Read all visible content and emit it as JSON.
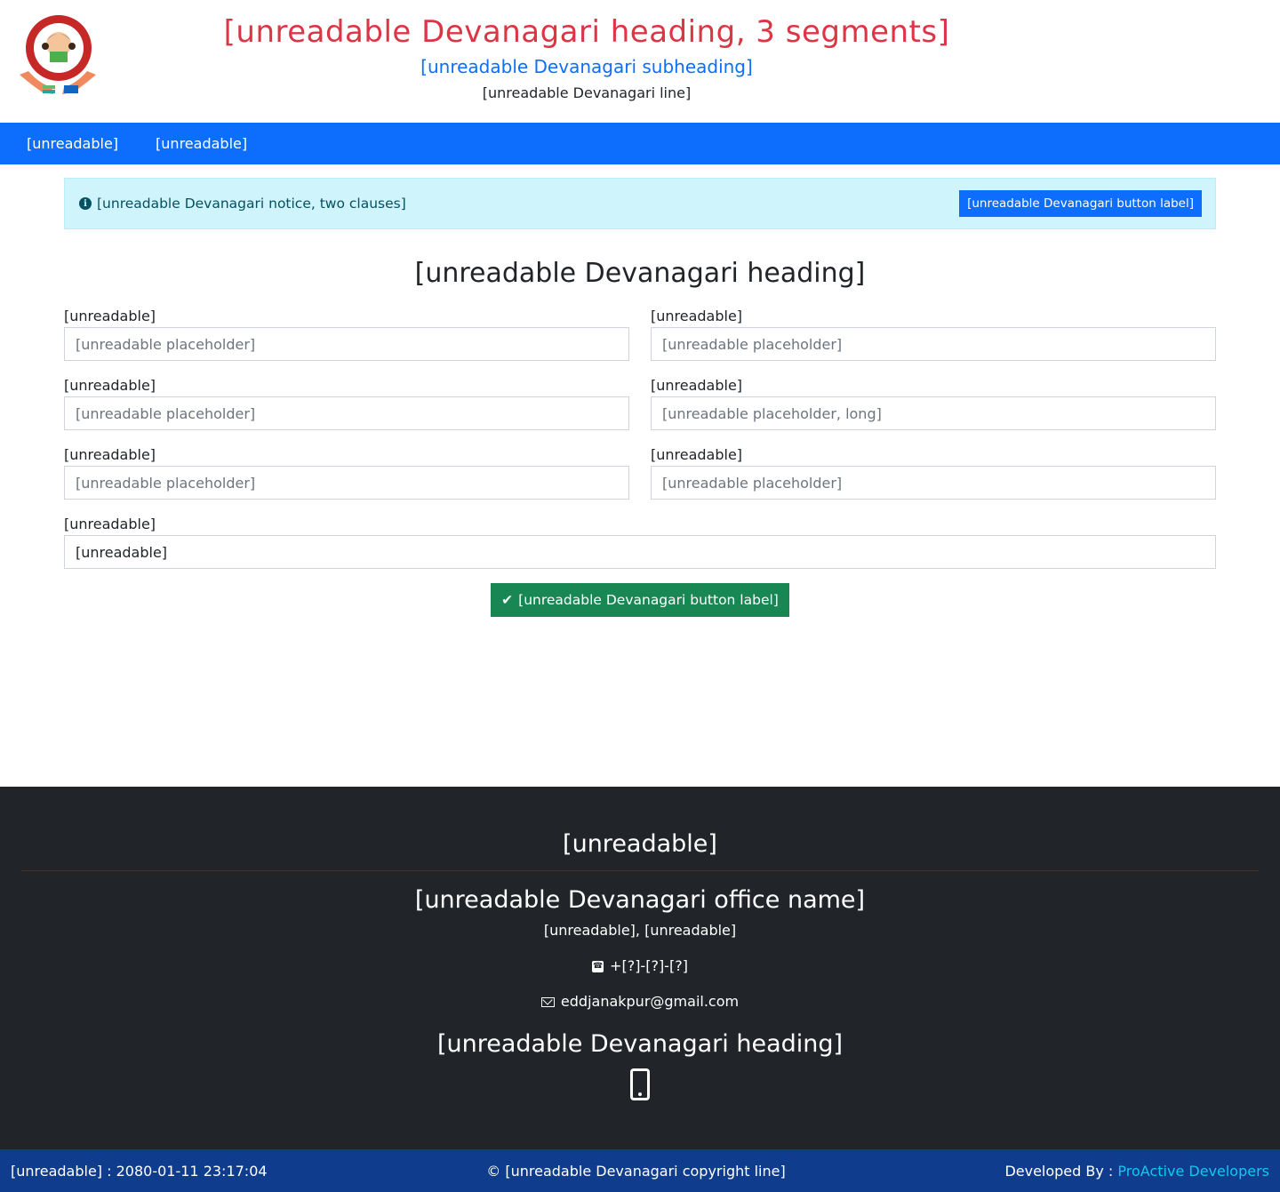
{
  "header": {
    "title": "[unreadable Devanagari heading, 3 segments]",
    "subtitle": "[unreadable Devanagari subheading]",
    "subsub": "[unreadable Devanagari line]"
  },
  "nav": {
    "items": [
      "[unreadable]",
      "[unreadable]"
    ]
  },
  "alert": {
    "text": "[unreadable Devanagari notice, two clauses]",
    "button": "[unreadable Devanagari button label]"
  },
  "form": {
    "heading": "[unreadable Devanagari heading]",
    "fields": [
      {
        "label": "[unreadable]",
        "placeholder": "[unreadable placeholder]"
      },
      {
        "label": "[unreadable]",
        "placeholder": "[unreadable placeholder]"
      },
      {
        "label": "[unreadable]",
        "placeholder": "[unreadable placeholder]"
      },
      {
        "label": "[unreadable]",
        "placeholder": "[unreadable placeholder, long]"
      },
      {
        "label": "[unreadable]",
        "placeholder": "[unreadable placeholder]"
      },
      {
        "label": "[unreadable]",
        "placeholder": "[unreadable placeholder]"
      }
    ],
    "select": {
      "label": "[unreadable]",
      "value": "[unreadable]"
    },
    "submit": "[unreadable Devanagari button label]"
  },
  "footer": {
    "title": "[unreadable]",
    "office": "[unreadable Devanagari office name]",
    "address": "[unreadable], [unreadable]",
    "phone": "+[?]-[?]-[?]",
    "email": "eddjanakpur@gmail.com",
    "app_title": "[unreadable Devanagari heading]"
  },
  "bottom": {
    "updated_label": "[unreadable] :",
    "updated_value": "2080-01-11 23:17:04",
    "copyright": "© [unreadable Devanagari copyright line]",
    "dev_label": "Developed By :",
    "dev_name": "ProActive Developers"
  },
  "colors": {
    "title": "#dc3545",
    "accent": "#0d6efd",
    "success": "#198754",
    "alert_bg": "#cff4fc",
    "footer_bg": "#212529",
    "bottom_bg": "#0f3c8c",
    "link": "#0dcaf0"
  },
  "icons": [
    "logo",
    "info-icon",
    "check-icon",
    "phone-icon",
    "mail-icon",
    "mobile-icon"
  ]
}
